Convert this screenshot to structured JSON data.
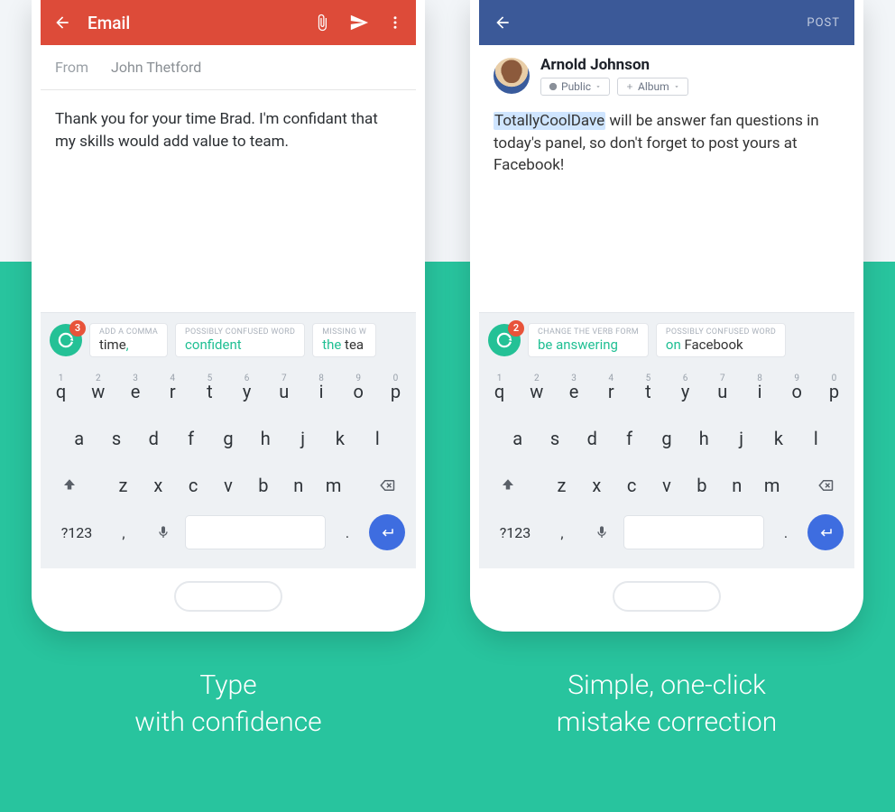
{
  "left": {
    "header": {
      "title": "Email"
    },
    "from": {
      "label": "From",
      "value": "John Thetford"
    },
    "body": "Thank you for your time Brad. I'm confidant that my skills would add value to team.",
    "grammarly": {
      "count": "3"
    },
    "suggestions": [
      {
        "label": "ADD A COMMA",
        "prefix": "time",
        "green": ",",
        "rest": ""
      },
      {
        "label": "POSSIBLY CONFUSED WORD",
        "prefix": "",
        "green": "confident",
        "rest": ""
      },
      {
        "label": "MISSING W",
        "prefix": "",
        "green": "the ",
        "rest": "tea"
      }
    ],
    "caption_line1": "Type",
    "caption_line2": "with confidence"
  },
  "right": {
    "header": {
      "post": "POST"
    },
    "user": {
      "name": "Arnold Johnson"
    },
    "chips": {
      "public": "Public",
      "album": "Album"
    },
    "body": {
      "highlight": "TotallyCoolDave",
      "rest": " will be answer fan questions in today's panel, so don't forget to post yours at Facebook!"
    },
    "grammarly": {
      "count": "2"
    },
    "suggestions": [
      {
        "label": "CHANGE THE VERB FORM",
        "prefix": "",
        "green": "be answering",
        "rest": ""
      },
      {
        "label": "POSSIBLY CONFUSED WORD",
        "prefix": "",
        "green": "on ",
        "rest": "Facebook"
      }
    ],
    "caption_line1": "Simple, one-click",
    "caption_line2": "mistake correction"
  },
  "keyboard": {
    "row1": [
      {
        "k": "q",
        "n": "1"
      },
      {
        "k": "w",
        "n": "2"
      },
      {
        "k": "e",
        "n": "3"
      },
      {
        "k": "r",
        "n": "4"
      },
      {
        "k": "t",
        "n": "5"
      },
      {
        "k": "y",
        "n": "6"
      },
      {
        "k": "u",
        "n": "7"
      },
      {
        "k": "i",
        "n": "8"
      },
      {
        "k": "o",
        "n": "9"
      },
      {
        "k": "p",
        "n": "0"
      }
    ],
    "row2": [
      "a",
      "s",
      "d",
      "f",
      "g",
      "h",
      "j",
      "k",
      "l"
    ],
    "row3": [
      "z",
      "x",
      "c",
      "v",
      "b",
      "n",
      "m"
    ],
    "sym": "?123",
    "comma": ",",
    "dot": "."
  }
}
